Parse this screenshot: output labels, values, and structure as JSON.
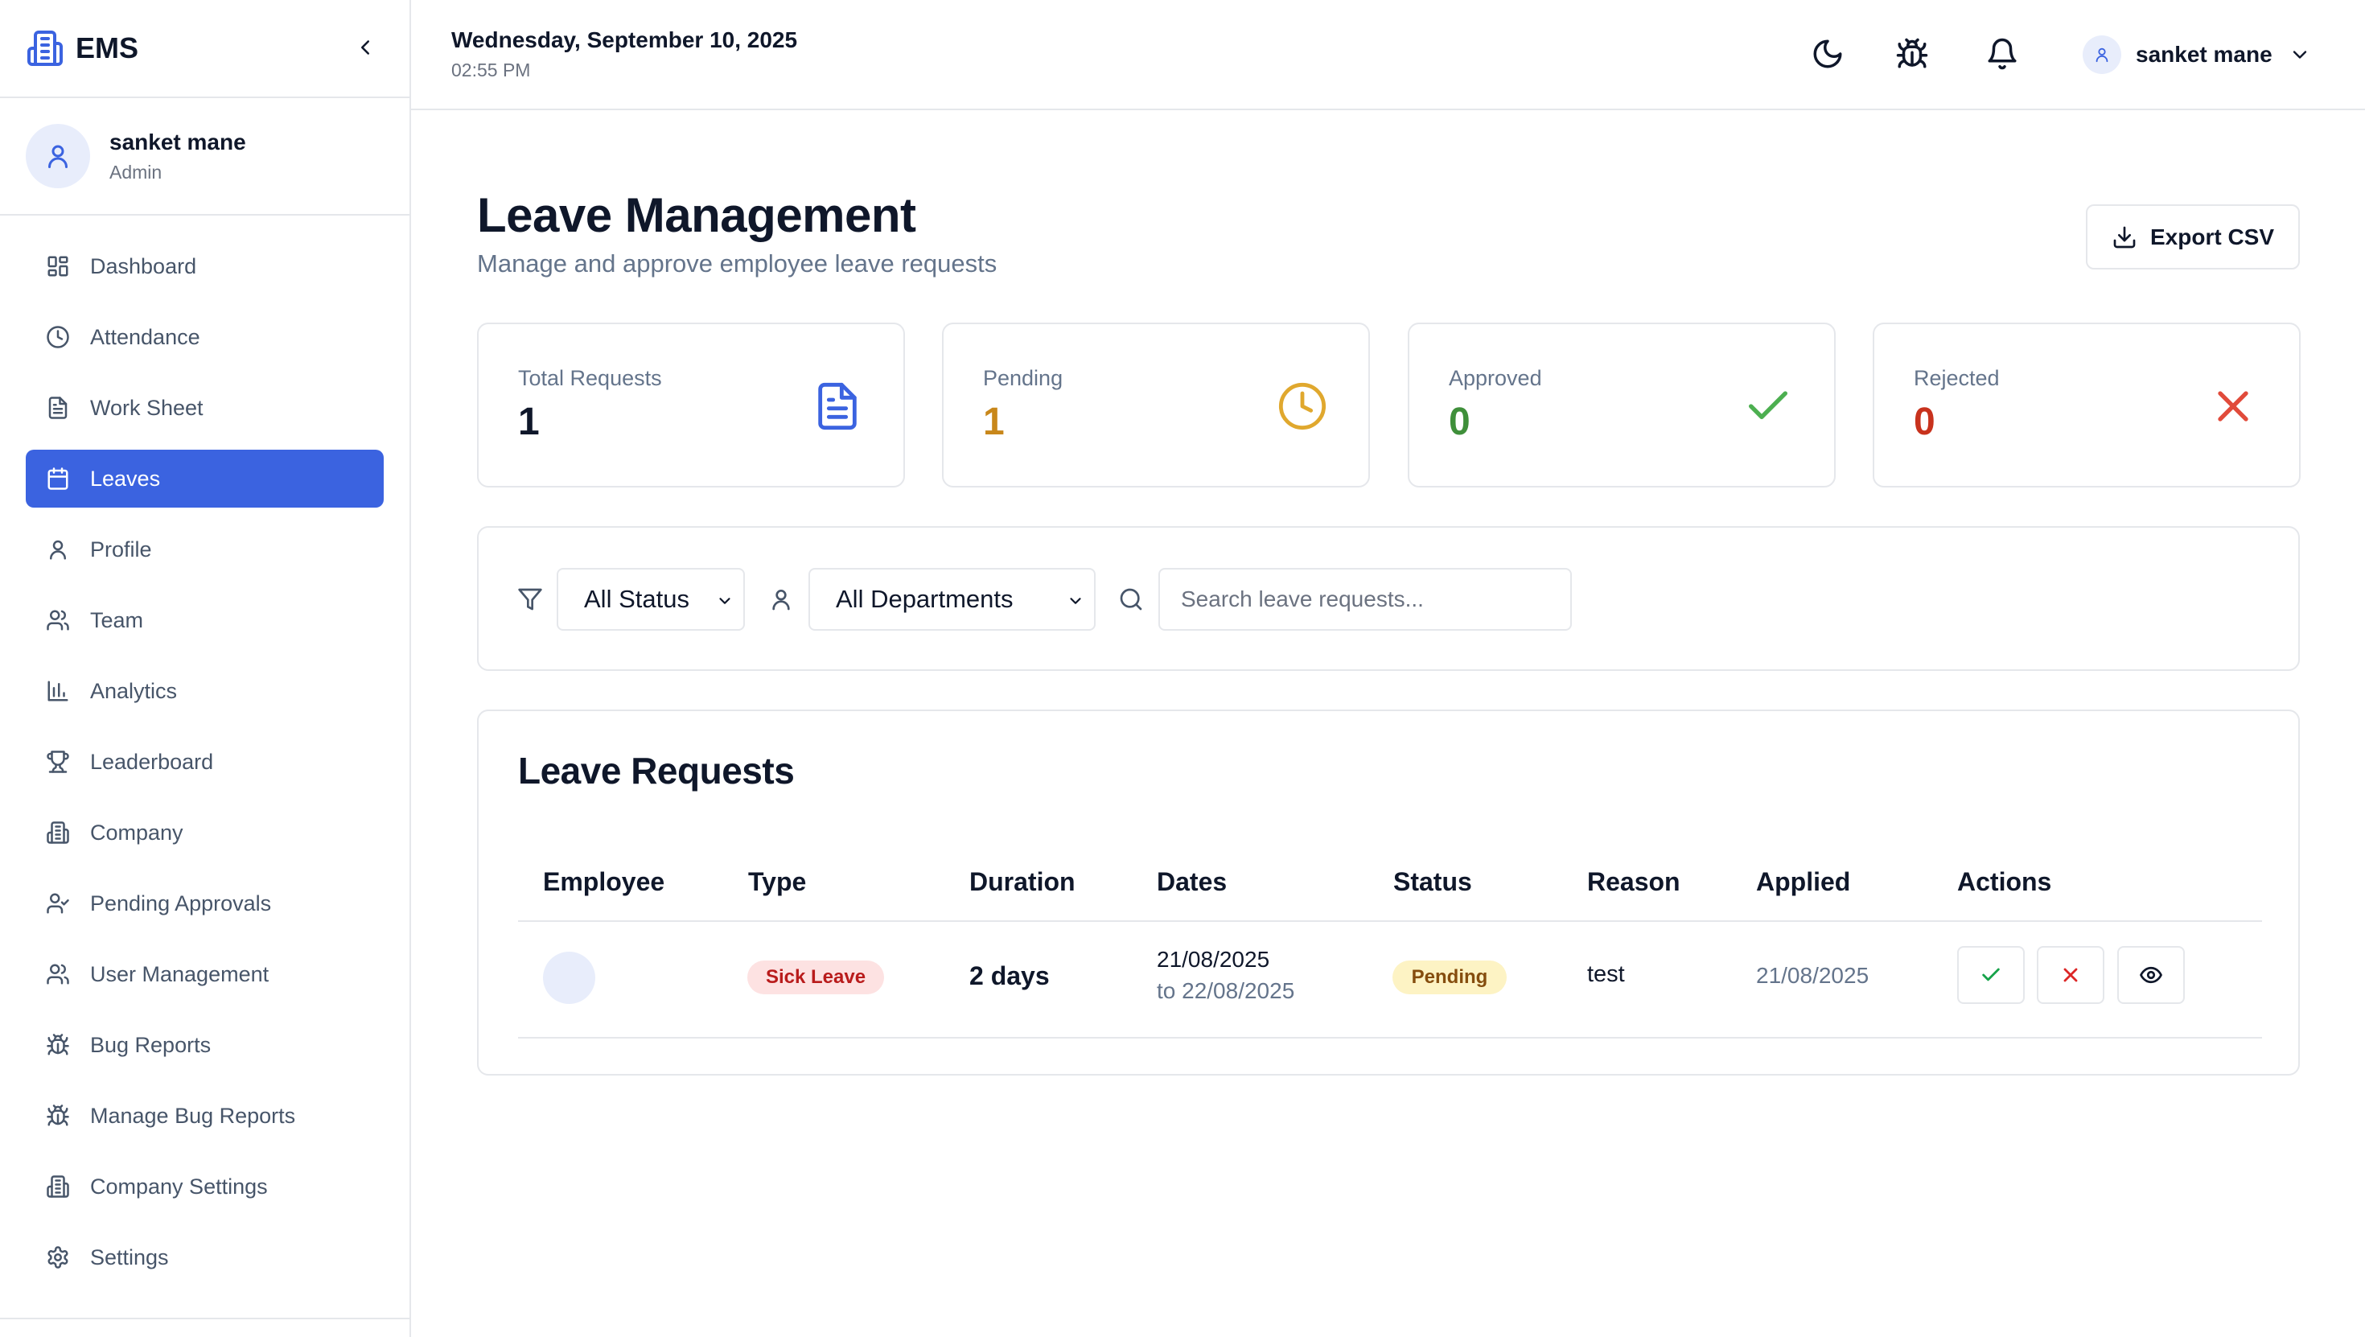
{
  "brand": {
    "name": "EMS"
  },
  "current_user": {
    "name": "sanket mane",
    "role": "Admin"
  },
  "sidebar": {
    "items": [
      {
        "label": "Dashboard",
        "icon": "dashboard-grid-icon"
      },
      {
        "label": "Attendance",
        "icon": "clock-icon"
      },
      {
        "label": "Work Sheet",
        "icon": "document-icon"
      },
      {
        "label": "Leaves",
        "icon": "calendar-icon",
        "active": true
      },
      {
        "label": "Profile",
        "icon": "user-icon"
      },
      {
        "label": "Team",
        "icon": "users-icon"
      },
      {
        "label": "Analytics",
        "icon": "bar-chart-icon"
      },
      {
        "label": "Leaderboard",
        "icon": "trophy-icon"
      },
      {
        "label": "Company",
        "icon": "building-icon"
      },
      {
        "label": "Pending Approvals",
        "icon": "user-check-icon"
      },
      {
        "label": "User Management",
        "icon": "users-cog-icon"
      },
      {
        "label": "Bug Reports",
        "icon": "bug-icon"
      },
      {
        "label": "Manage Bug Reports",
        "icon": "bug-icon"
      },
      {
        "label": "Company Settings",
        "icon": "building-icon"
      },
      {
        "label": "Settings",
        "icon": "gear-icon"
      }
    ]
  },
  "topbar": {
    "date": "Wednesday, September 10, 2025",
    "time": "02:55 PM",
    "user_name": "sanket mane"
  },
  "page": {
    "title": "Leave Management",
    "subtitle": "Manage and approve employee leave requests",
    "export_label": "Export CSV"
  },
  "stats": [
    {
      "label": "Total Requests",
      "value": "1",
      "color": "#0f172a",
      "icon": "document-icon",
      "icon_color": "#3b63e0"
    },
    {
      "label": "Pending",
      "value": "1",
      "color": "#c8871a",
      "icon": "clock-icon",
      "icon_color": "#e0a82e"
    },
    {
      "label": "Approved",
      "value": "0",
      "color": "#3f8f3a",
      "icon": "check-icon",
      "icon_color": "#4caf50"
    },
    {
      "label": "Rejected",
      "value": "0",
      "color": "#c8321d",
      "icon": "x-icon",
      "icon_color": "#e14b3b"
    }
  ],
  "filters": {
    "status": "All Status",
    "department": "All Departments",
    "search_placeholder": "Search leave requests..."
  },
  "requests": {
    "title": "Leave Requests",
    "columns": [
      "Employee",
      "Type",
      "Duration",
      "Dates",
      "Status",
      "Reason",
      "Applied",
      "Actions"
    ],
    "rows": [
      {
        "employee": "",
        "type": "Sick Leave",
        "duration": "2 days",
        "date_from": "21/08/2025",
        "date_to": "to 22/08/2025",
        "status": "Pending",
        "reason": "test",
        "applied": "21/08/2025"
      }
    ]
  },
  "colors": {
    "accent": "#3b63e0",
    "sick_leave_bg": "#fde2e2",
    "sick_leave_fg": "#b91c1c",
    "pending_bg": "#fdf3c4",
    "pending_fg": "#854d0e"
  }
}
